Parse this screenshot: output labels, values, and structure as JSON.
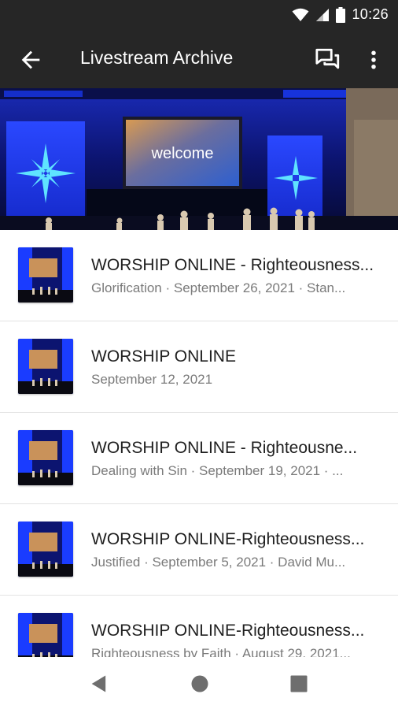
{
  "status_bar": {
    "time": "10:26"
  },
  "app_bar": {
    "title": "Livestream Archive"
  },
  "hero": {
    "screen_text": "welcome"
  },
  "items": [
    {
      "title": "WORSHIP ONLINE - Righteousness...",
      "subtitle": "Glorification · September 26, 2021 · Stan..."
    },
    {
      "title": "WORSHIP ONLINE",
      "subtitle": "September 12, 2021"
    },
    {
      "title": "WORSHIP ONLINE - Righteousne...",
      "subtitle": "Dealing with Sin · September 19, 2021 · ..."
    },
    {
      "title": "WORSHIP ONLINE-Righteousness...",
      "subtitle": "Justified · September 5, 2021 · David Mu..."
    },
    {
      "title": "WORSHIP ONLINE-Righteousness...",
      "subtitle": "Righteousness by Faith · August 29, 2021..."
    }
  ],
  "colors": {
    "bar_bg": "#262626",
    "stage_blue": "#1a3cff",
    "text_primary": "#202020",
    "text_secondary": "#7a7a7a"
  },
  "icons": [
    "wifi-icon",
    "signal-icon",
    "battery-icon",
    "back-arrow-icon",
    "chat-icon",
    "more-vert-icon",
    "nav-back-icon",
    "nav-home-icon",
    "nav-recents-icon"
  ]
}
